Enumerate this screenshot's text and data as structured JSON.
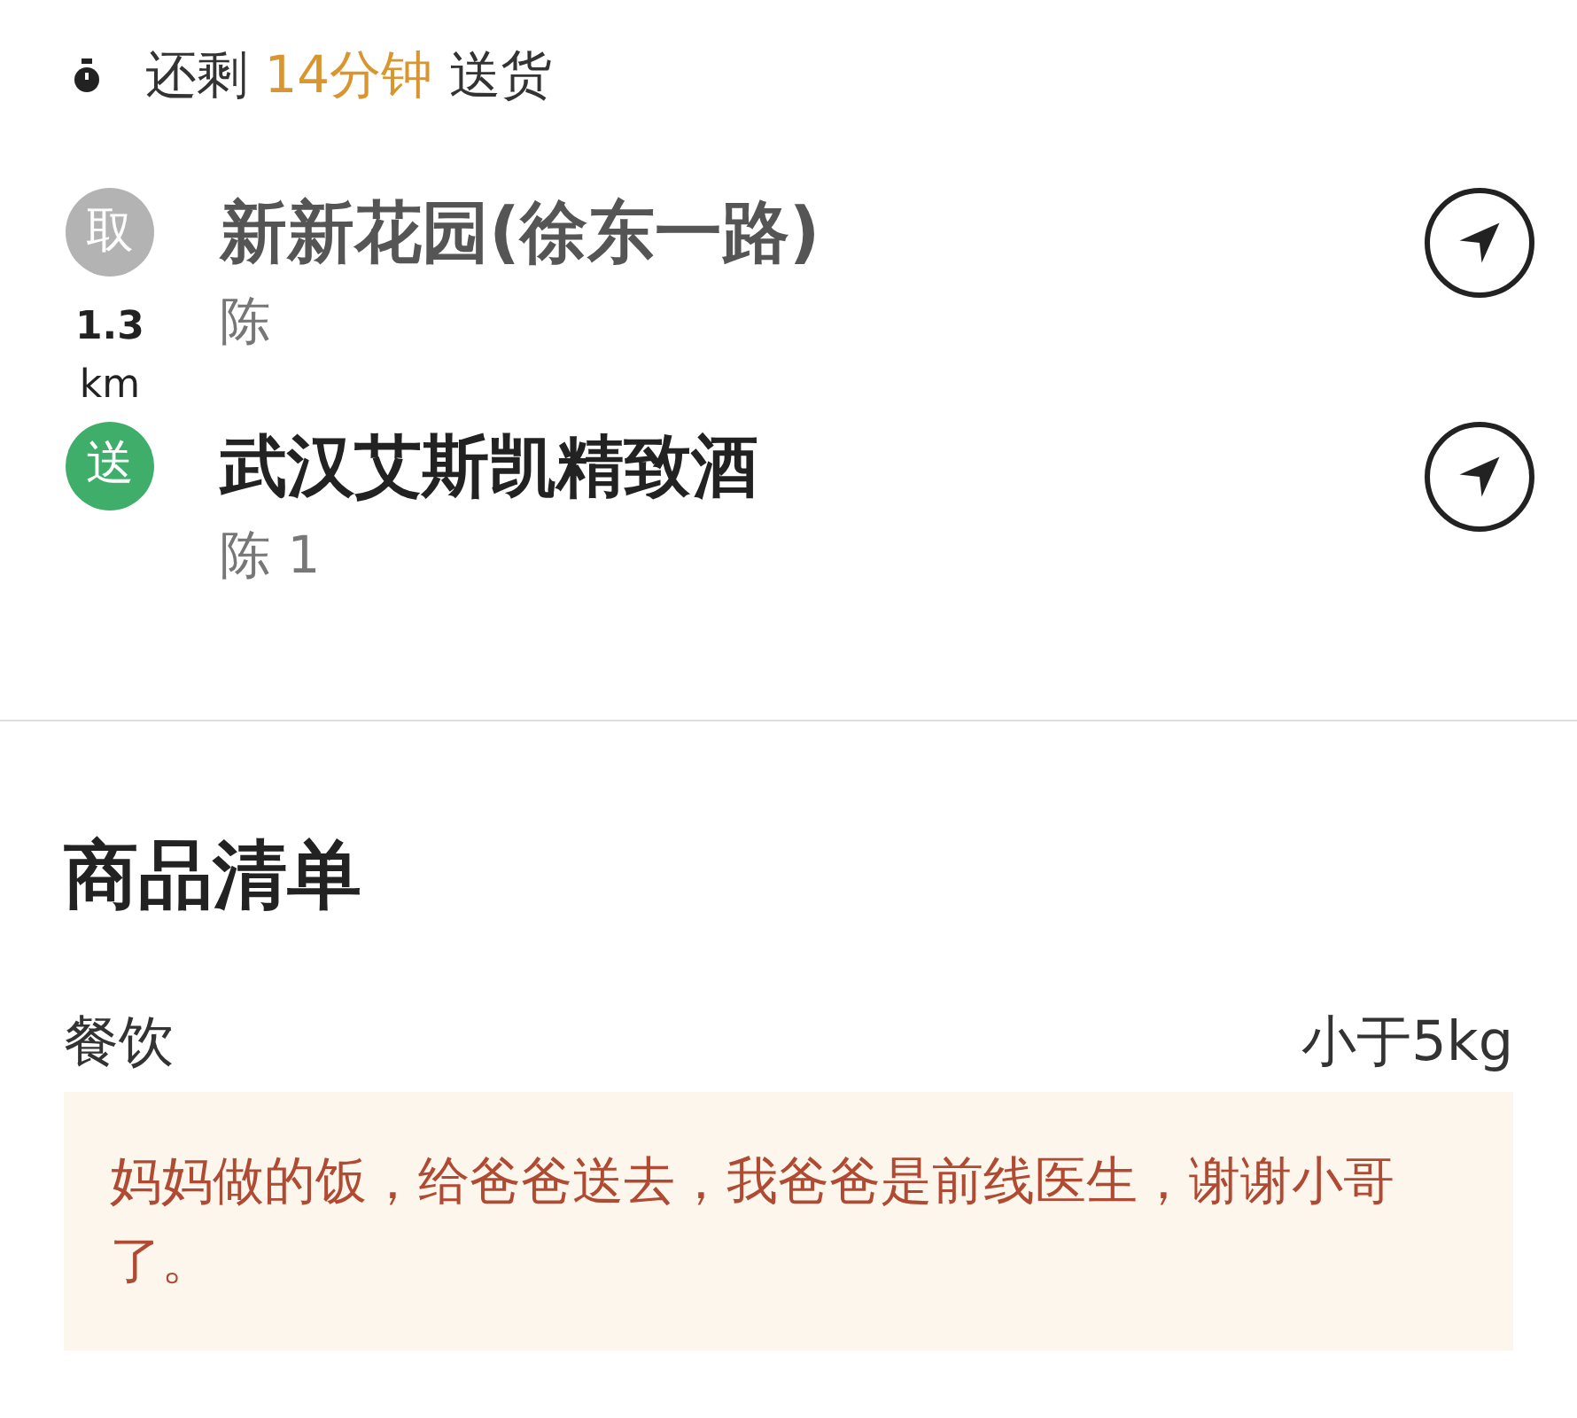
{
  "countdown": {
    "prefix": "还剩",
    "time": "14分钟",
    "suffix": "送货"
  },
  "distance": {
    "value": "1.3",
    "unit": "km"
  },
  "stops": [
    {
      "kind": "pickup",
      "badge": "取",
      "name": "新新花园(徐东一路)",
      "contact": "陈"
    },
    {
      "kind": "delivery",
      "badge": "送",
      "name": "武汉艾斯凯精致酒",
      "contact": "陈 1"
    }
  ],
  "goods": {
    "title": "商品清单",
    "category": "餐饮",
    "weight": "小于5kg",
    "note": "妈妈做的饭，给爸爸送去，我爸爸是前线医生，谢谢小哥了。"
  }
}
